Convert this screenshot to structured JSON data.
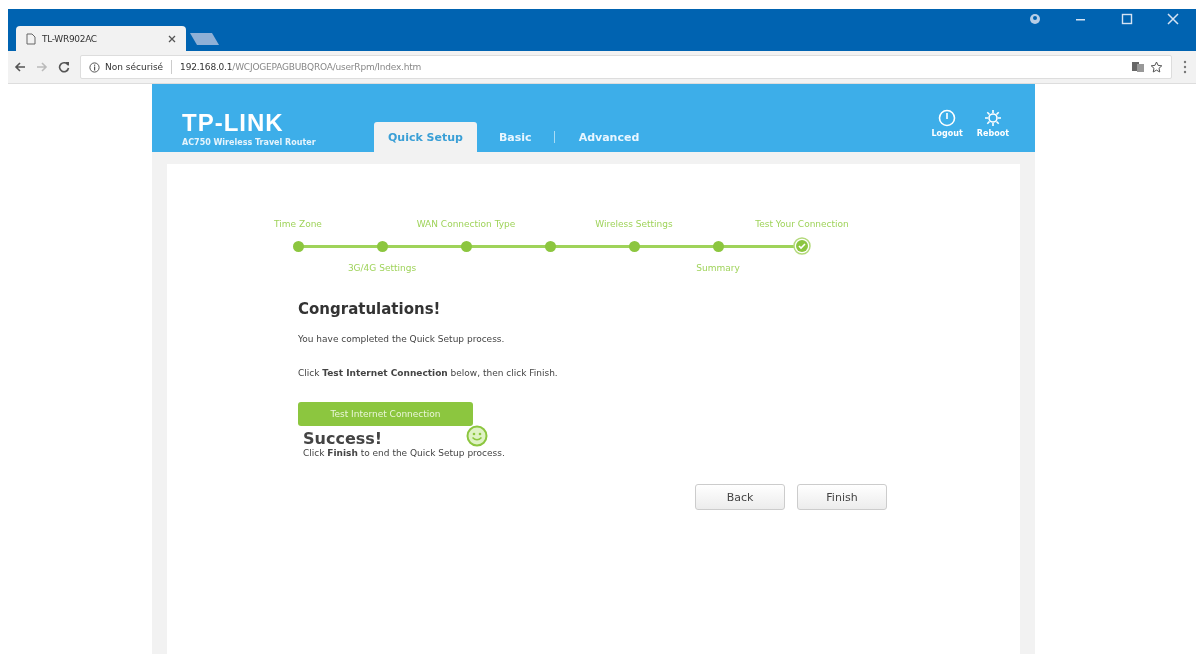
{
  "browser": {
    "tab_title": "TL-WR902AC",
    "security_label": "Non sécurisé",
    "url_host": "192.168.0.1",
    "url_path": "/WCJOGEPAGBUBQROA/userRpm/Index.htm"
  },
  "header": {
    "brand": "TP-LINK",
    "model": "AC750 Wireless Travel Router",
    "nav": [
      {
        "label": "Quick Setup",
        "selected": true
      },
      {
        "label": "Basic",
        "selected": false
      },
      {
        "label": "Advanced",
        "selected": false
      }
    ],
    "actions": [
      {
        "label": "Logout",
        "kind": "logout"
      },
      {
        "label": "Reboot",
        "kind": "reboot"
      }
    ]
  },
  "wizard": {
    "steps": [
      {
        "label_above": "Time Zone",
        "kind": "dot"
      },
      {
        "label_below": "3G/4G Settings",
        "kind": "dot"
      },
      {
        "label_above": "WAN Connection Type",
        "kind": "dot"
      },
      {
        "kind": "dot"
      },
      {
        "label_above": "Wireless Settings",
        "kind": "dot"
      },
      {
        "label_below": "Summary",
        "kind": "dot"
      },
      {
        "label_above": "Test Your Connection",
        "kind": "check"
      }
    ]
  },
  "content": {
    "heading": "Congratulations!",
    "paragraphs": [
      "You have completed the Quick Setup process.",
      "Click **Test Internet Connection** below, then click Finish."
    ],
    "test_button": "Test Internet Connection",
    "result": {
      "title": "Success!",
      "message": "Click **Finish** to end the Quick Setup process."
    },
    "buttons": [
      "Back",
      "Finish"
    ]
  }
}
